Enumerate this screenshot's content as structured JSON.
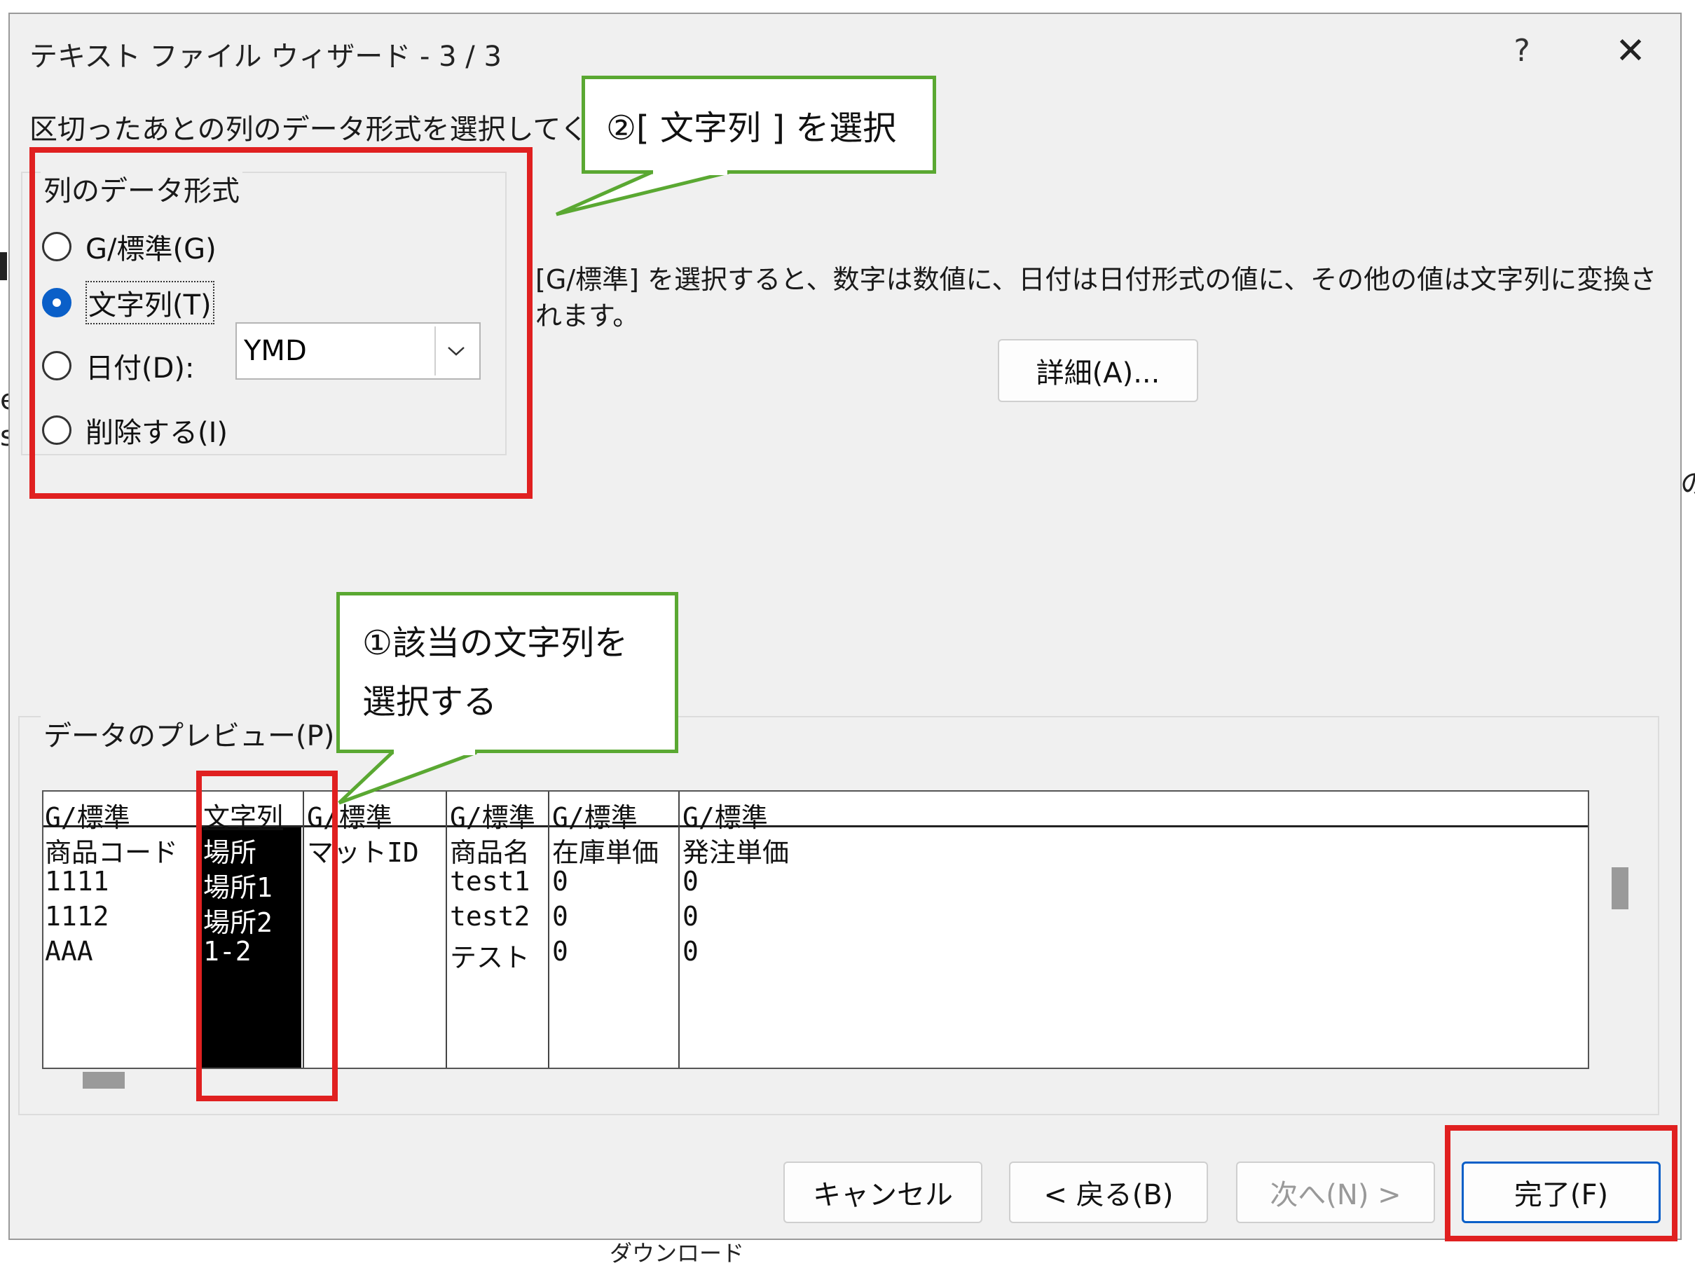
{
  "background": {
    "fragments": [
      "e",
      "s",
      "の",
      "ダウンロード"
    ]
  },
  "dialog": {
    "title": "テキスト ファイル ウィザード - 3 / 3",
    "help_label": "?",
    "close_label": "✕",
    "instruction": "区切ったあとの列のデータ形式を選択してください。",
    "format_group": {
      "title": "列のデータ形式",
      "options": [
        {
          "label": "G/標準(G)",
          "checked": false
        },
        {
          "label": "文字列(T)",
          "checked": true
        },
        {
          "label": "日付(D):",
          "checked": false
        },
        {
          "label": "削除する(I)",
          "checked": false
        }
      ],
      "date_format": "YMD"
    },
    "description": [
      "[G/標準] を選択すると、数字は数値に、日付は日付形式の値に、その他の値は文字列に変換さ",
      "れます。"
    ],
    "advanced_button": "詳細(A)...",
    "preview": {
      "title": "データのプレビュー(P)",
      "headers": [
        "G/標準",
        "文字列",
        "G/標準",
        "G/標準",
        "G/標準",
        "G/標準"
      ],
      "rows": [
        [
          "商品コード",
          "場所",
          "マットID",
          "商品名",
          "在庫単価",
          "発注単価"
        ],
        [
          "1111",
          "場所1",
          "",
          "test1",
          "0",
          "0"
        ],
        [
          "1112",
          "場所2",
          "",
          "test2",
          "0",
          "0"
        ],
        [
          "AAA",
          "1-2",
          "",
          "テスト",
          "0",
          "0"
        ]
      ],
      "selected_column": 1
    },
    "buttons": {
      "cancel": "キャンセル",
      "back": "< 戻る(B)",
      "next": "次へ(N) >",
      "finish": "完了(F)"
    }
  },
  "annotations": {
    "callout_1": [
      "①該当の文字列を",
      "選択する"
    ],
    "callout_2": "②[ 文字列 ] を選択",
    "highlight_color": "#e02020",
    "callout_border_color": "#5aa832"
  },
  "colors": {
    "accent": "#0a5fc8",
    "dialog_bg": "#f0f0f0"
  }
}
